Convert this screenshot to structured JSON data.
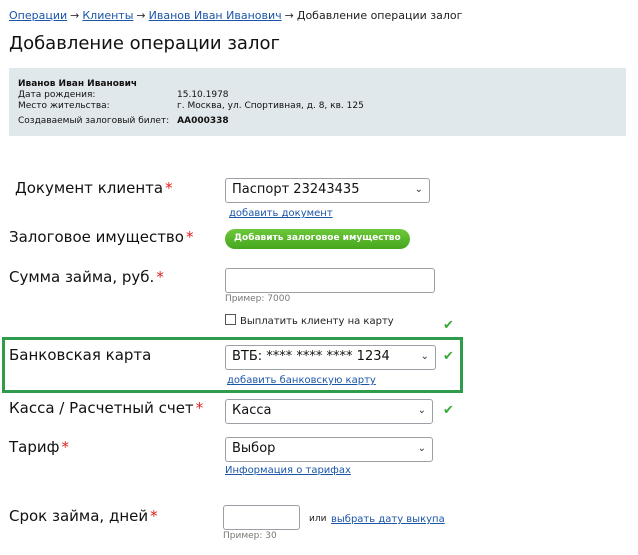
{
  "breadcrumb": {
    "items": [
      "Операции",
      "Клиенты",
      "Иванов Иван Иванович"
    ],
    "current": "Добавление операции залог",
    "separator": "→"
  },
  "page_title": "Добавление операции залог",
  "client_info": {
    "name": "Иванов Иван Иванович",
    "birth_label": "Дата рождения:",
    "birth_value": "15.10.1978",
    "address_label": "Место жительства:",
    "address_value": "г. Москва, ул. Спортивная, д. 8, кв. 125",
    "ticket_label": "Создаваемый залоговый билет:",
    "ticket_value": "АА000338"
  },
  "form": {
    "document": {
      "label": "Документ клиента",
      "value": "Паспорт 23243435",
      "link": "добавить документ"
    },
    "collateral": {
      "label": "Залоговое имущество",
      "button": "Добавить залоговое имущество"
    },
    "loan_amount": {
      "label": "Сумма займа, руб.",
      "value": "",
      "hint": "Пример: 7000",
      "checkbox_label": "Выплатить клиенту на карту"
    },
    "bank_card": {
      "label": "Банковская карта",
      "value": "ВТБ: **** **** **** 1234",
      "link": "добавить банковскую карту"
    },
    "cash": {
      "label": "Касса / Расчетный счет",
      "value": "Касса"
    },
    "tariff": {
      "label": "Тариф",
      "value": "Выбор",
      "link": "Информация о тарифах"
    },
    "term": {
      "label": "Срок займа, дней",
      "value": "",
      "or_text": "или",
      "link": "выбрать дату выкупа",
      "hint": "Пример: 30"
    },
    "required_mark": "*"
  },
  "colors": {
    "accent_link": "#1a55a8",
    "required": "#e02020",
    "highlight": "#2e9c4a",
    "info_bg": "#e1e8eb"
  },
  "icons": {
    "chevron": "chevron-down-icon",
    "check": "checkmark-icon"
  }
}
